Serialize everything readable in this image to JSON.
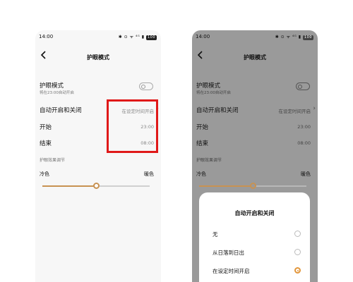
{
  "status_bar": {
    "time": "14:00",
    "icons": "✱ ⊙ ᯤ ⁴ᴳ ▮",
    "battery": "100"
  },
  "header": {
    "title": "护眼模式"
  },
  "eye_mode": {
    "label": "护眼模式",
    "sub": "将在23:00自动开启",
    "enabled": false
  },
  "auto": {
    "label": "自动开启和关闭",
    "value": "在设定时间开启"
  },
  "start": {
    "label": "开始",
    "value": "23:00"
  },
  "end": {
    "label": "结束",
    "value": "08:00"
  },
  "effect": {
    "section_label": "护眼效果调节",
    "cool_label": "冷色",
    "warm_label": "暖色",
    "level": 0.5
  },
  "sheet": {
    "title": "自动开启和关闭",
    "options": [
      {
        "label": "无",
        "selected": false
      },
      {
        "label": "从日落到日出",
        "selected": false
      },
      {
        "label": "在设定时间开启",
        "selected": true
      }
    ]
  },
  "colors": {
    "accent": "#c89252",
    "highlight": "#e01919"
  }
}
